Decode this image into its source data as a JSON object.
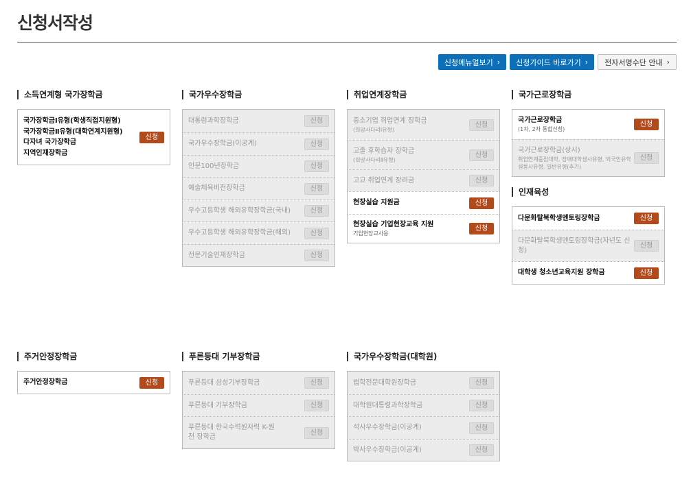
{
  "page": {
    "title": "신청서작성"
  },
  "toolbar": {
    "menu_label": "신청메뉴얼보기",
    "guide_label": "신청가이드 바로가기",
    "esign_label": "전자서명수단 안내"
  },
  "sections": {
    "income": {
      "title": "소득연계형 국가장학금",
      "lines": [
        "국가장학금Ⅰ유형(학생직접지원형)",
        "국가장학금Ⅱ유형(대학연계지원형)",
        "다자녀 국가장학금",
        "지역인재장학금"
      ],
      "button": "신청"
    },
    "excellence": {
      "title": "국가우수장학금",
      "items": [
        {
          "name": "대통령과학장학금",
          "button": "신청"
        },
        {
          "name": "국가우수장학금(이공계)",
          "button": "신청"
        },
        {
          "name": "인문100년장학금",
          "button": "신청"
        },
        {
          "name": "예술체육비전장학금",
          "button": "신청"
        },
        {
          "name": "우수고등학생 해외유학장학금(국내)",
          "button": "신청"
        },
        {
          "name": "우수고등학생 해외유학장학금(해외)",
          "button": "신청"
        },
        {
          "name": "전문기술인재장학금",
          "button": "신청"
        }
      ]
    },
    "employment": {
      "title": "취업연계장학금",
      "items": [
        {
          "name": "중소기업 취업연계 장학금",
          "sub": "(희망사다리Ⅰ유형)",
          "button": "신청"
        },
        {
          "name": "고졸 후학습자 장학금",
          "sub": "(희망사다리Ⅱ유형)",
          "button": "신청"
        },
        {
          "name": "고교 취업연계 장려금",
          "button": "신청"
        },
        {
          "name": "현장실습 지원금",
          "button": "신청"
        },
        {
          "name": "현장실습 기업현장교육 지원",
          "sub": "기업현장교사용",
          "button": "신청"
        }
      ]
    },
    "work": {
      "title": "국가근로장학금",
      "items": [
        {
          "name": "국가근로장학금",
          "sub": "(1차, 2차 통합신청)",
          "button": "신청"
        },
        {
          "name": "국가근로장학금(상시)",
          "sub": "취업연계중점대학, 장애대학생사유형, 외국인유학생봉사유형, 일반유형(추가)",
          "button": "신청"
        }
      ]
    },
    "talent": {
      "title": "인재육성",
      "items": [
        {
          "name": "다문화탈북학생멘토링장학금",
          "button": "신청"
        },
        {
          "name": "다문화탈북학생멘토링장학금(자년도 신청)",
          "button": "신청"
        },
        {
          "name": "대학생 청소년교육지원 장학금",
          "button": "신청"
        }
      ]
    },
    "housing": {
      "title": "주거안정장학금",
      "items": [
        {
          "name": "주거안정장학금",
          "button": "신청"
        }
      ]
    },
    "dream": {
      "title": "푸른등대 기부장학금",
      "items": [
        {
          "name": "푸른등대 삼성기부장학금",
          "button": "신청"
        },
        {
          "name": "푸른등대 기부장학금",
          "button": "신청"
        },
        {
          "name": "푸른등대 한국수력원자력 K-원전 장학금",
          "button": "신청"
        }
      ]
    },
    "grad": {
      "title": "국가우수장학금(대학원)",
      "items": [
        {
          "name": "법학전문대학원장학금",
          "button": "신청"
        },
        {
          "name": "대학원대통령과학장학금",
          "button": "신청"
        },
        {
          "name": "석사우수장학금(이공계)",
          "button": "신청"
        },
        {
          "name": "박사우수장학금(이공계)",
          "button": "신청"
        }
      ]
    }
  }
}
